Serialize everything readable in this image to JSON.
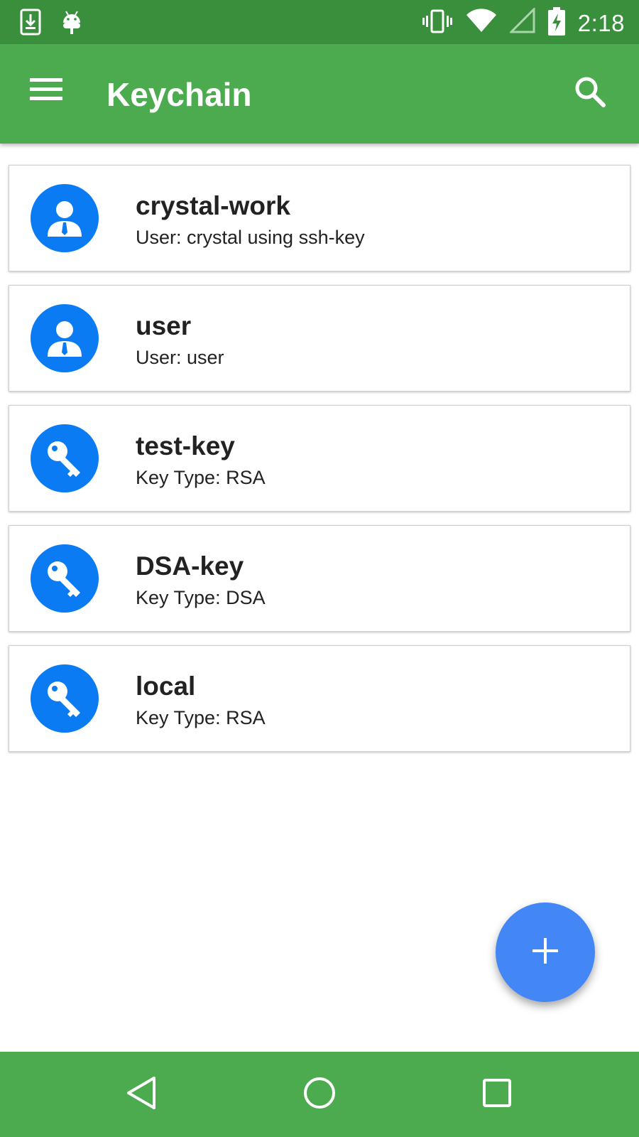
{
  "status_bar": {
    "time": "2:18",
    "left_icons": [
      "download-icon",
      "android-debug-icon"
    ],
    "right_icons": [
      "vibrate-icon",
      "wifi-icon",
      "cell-signal-icon",
      "battery-charging-icon"
    ]
  },
  "app_bar": {
    "title": "Keychain",
    "menu_icon": "menu-icon",
    "search_icon": "search-icon"
  },
  "keychain": {
    "items": [
      {
        "title": "crystal-work",
        "subtitle": "User: crystal using ssh-key",
        "icon": "user-icon"
      },
      {
        "title": "user",
        "subtitle": "User: user",
        "icon": "user-icon"
      },
      {
        "title": "test-key",
        "subtitle": "Key Type: RSA",
        "icon": "key-icon"
      },
      {
        "title": "DSA-key",
        "subtitle": "Key Type: DSA",
        "icon": "key-icon"
      },
      {
        "title": "local",
        "subtitle": "Key Type: RSA",
        "icon": "key-icon"
      }
    ]
  },
  "fab": {
    "icon": "add-icon"
  },
  "nav_bar": {
    "icons": [
      "back-icon",
      "home-icon",
      "recents-icon"
    ]
  },
  "colors": {
    "status_bar": "#3a8f3d",
    "app_bar": "#4caa4f",
    "avatar": "#0a7bf2",
    "fab": "#4387f6"
  }
}
